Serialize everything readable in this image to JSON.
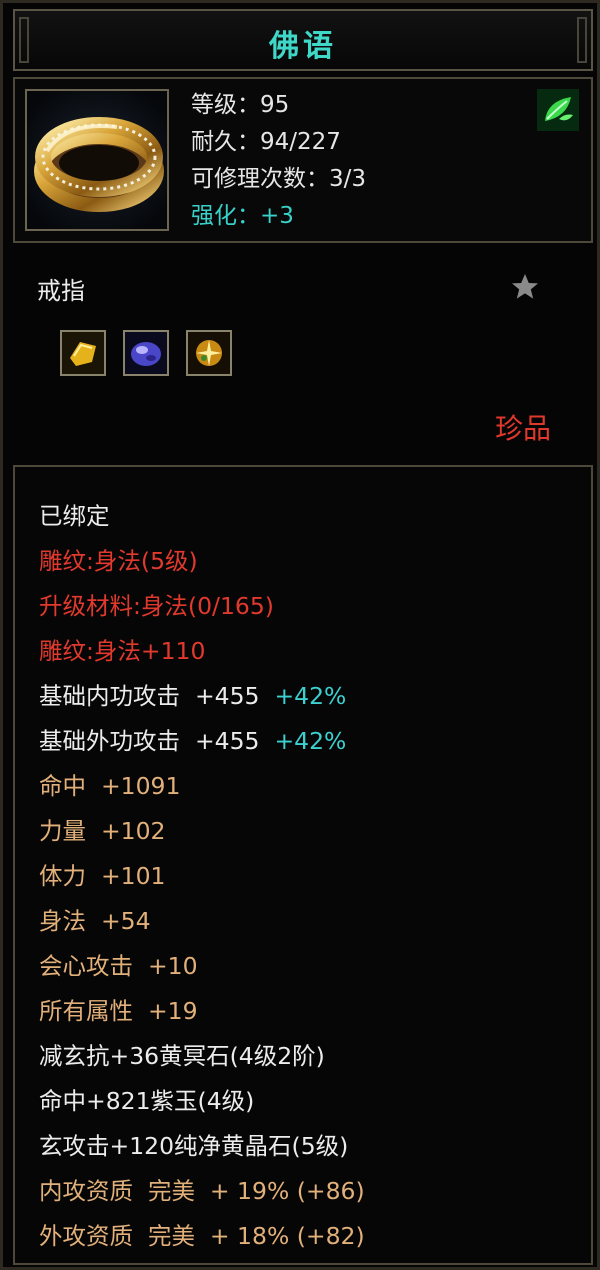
{
  "title": "佛语",
  "header": {
    "level": "等级：95",
    "durability": "耐久：94/227",
    "repair_count": "可修理次数：3/3",
    "enhance": "强化：+3"
  },
  "item_type": "戒指",
  "rarity": "珍品",
  "gems": [
    "yellow-gem-icon",
    "purple-gem-icon",
    "orange-gem-icon"
  ],
  "attributes": [
    {
      "text": "已绑定",
      "color": "#ececec"
    },
    {
      "text": "雕纹:身法(5级)",
      "color": "#e2392e"
    },
    {
      "text": "升级材料:身法(0/165)",
      "color": "#e2392e"
    },
    {
      "text": "雕纹:身法+110",
      "color": "#e2392e"
    },
    {
      "text": "基础内功攻击  +455",
      "extra": "+42%",
      "color": "#ececec"
    },
    {
      "text": "基础外功攻击  +455",
      "extra": "+42%",
      "color": "#ececec"
    },
    {
      "text": "命中  +1091",
      "color": "#e2b07a"
    },
    {
      "text": "力量  +102",
      "color": "#e2b07a"
    },
    {
      "text": "体力  +101",
      "color": "#e2b07a"
    },
    {
      "text": "身法  +54",
      "color": "#e2b07a"
    },
    {
      "text": "会心攻击  +10",
      "color": "#e2b07a"
    },
    {
      "text": "所有属性  +19",
      "color": "#e2b07a"
    },
    {
      "text": "减玄抗+36黄冥石(4级2阶)",
      "color": "#ececec"
    },
    {
      "text": "命中+821紫玉(4级)",
      "color": "#ececec"
    },
    {
      "text": "玄攻击+120纯净黄晶石(5级)",
      "color": "#ececec"
    },
    {
      "text": "内攻资质  完美  + 19% (+86)",
      "color": "#e2b07a"
    },
    {
      "text": "外攻资质  完美  + 18% (+82)",
      "color": "#e2b07a"
    }
  ]
}
